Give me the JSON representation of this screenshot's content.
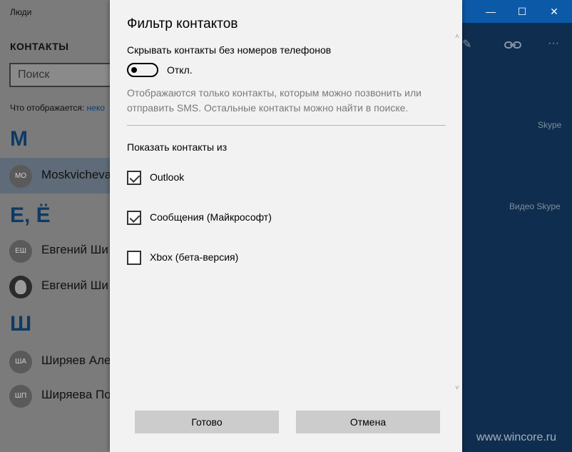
{
  "app": {
    "title": "Люди",
    "contacts_heading": "КОНТАКТЫ",
    "search_placeholder": "Поиск",
    "showing_label": "Что отображается:",
    "showing_link": "неко",
    "groups": [
      {
        "letter": "М",
        "contacts": [
          {
            "initials": "MO",
            "name": "Moskvicheva",
            "selected": true
          }
        ]
      },
      {
        "letter": "Е, Ё",
        "contacts": [
          {
            "initials": "ЕШ",
            "name": "Евгений Ши"
          },
          {
            "initials": "",
            "name": "Евгений Ши",
            "photo": true
          }
        ]
      },
      {
        "letter": "Ш",
        "contacts": [
          {
            "initials": "ША",
            "name": "Ширяев Але"
          },
          {
            "initials": "ШП",
            "name": "Ширяева По"
          }
        ]
      }
    ],
    "right_pane": {
      "skype_label": "Skype",
      "video_skype_label": "Видео Skype",
      "icons": [
        "edit-icon",
        "link-icon",
        "more-icon"
      ]
    },
    "window_controls": {
      "minimize": "—",
      "maximize": "☐",
      "close": "✕"
    }
  },
  "dialog": {
    "title": "Фильтр контактов",
    "hide_setting_label": "Скрывать контакты без номеров телефонов",
    "toggle_state": "Откл.",
    "toggle_on": false,
    "description": "Отображаются только контакты, которым можно позвонить или отправить SMS. Остальные контакты можно найти в поиске.",
    "show_from_label": "Показать контакты из",
    "sources": [
      {
        "label": "Outlook",
        "checked": true
      },
      {
        "label": "Сообщения (Майкрософт)",
        "checked": true
      },
      {
        "label": "Xbox (бета-версия)",
        "checked": false
      }
    ],
    "done_label": "Готово",
    "cancel_label": "Отмена"
  },
  "watermark": "www.wincore.ru",
  "colors": {
    "accent": "#0c59a8",
    "dialog_bg": "#f2f2f2",
    "button_bg": "#cccccc"
  }
}
